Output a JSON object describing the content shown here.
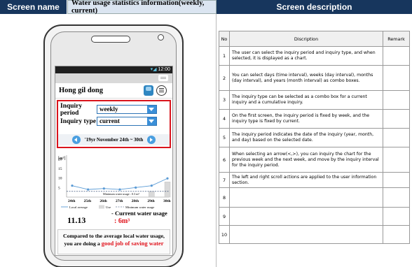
{
  "header": {
    "screen_name_label": "Screen name",
    "screen_title": "Water usage statistics information(weekly, current)",
    "screen_description_label": "Screen description"
  },
  "phone": {
    "status_time": "12:00",
    "user_name": "Hong gil dong",
    "inquiry_period_label": "Inquiry period",
    "inquiry_period_value": "weekly",
    "inquiry_type_label": "Inquiry type",
    "inquiry_type_value": "current",
    "date_range": "'19yr November 24th ~ 30th",
    "current_usage_label": "- Current water usage",
    "current_usage_amount": ": 6m³",
    "local_average_value": "11.13",
    "message_line1": "Compared to the average local water usage,",
    "message_line2_prefix": "you are doing a",
    "message_line2_highlight": "good job of saving water"
  },
  "chart_data": {
    "type": "bar",
    "ylabel": "[m³]",
    "yticks": [
      5,
      10,
      15,
      20
    ],
    "ylim": [
      0,
      22
    ],
    "categories": [
      "24th",
      "25th",
      "26th",
      "27th",
      "28th",
      "29th",
      "30th"
    ],
    "series": [
      {
        "name": "Local average",
        "type": "line",
        "values": [
          6,
          4,
          4.5,
          4,
          5,
          6,
          9.8
        ]
      },
      {
        "name": "Use",
        "type": "bar",
        "values": [
          0,
          0,
          0,
          0,
          0,
          3,
          8
        ]
      },
      {
        "name": "Minimum water usage",
        "type": "dashed-line",
        "values": [
          3,
          3,
          3,
          3,
          3,
          3,
          3
        ]
      }
    ],
    "annotation": "Minimum water usage : 0.3 m³",
    "legend": [
      "Local average",
      "Use",
      "Minimum water usage"
    ],
    "colors": {
      "line": "#5b9bd5",
      "bar": "#d9d9d9",
      "dashed": "#1f3864"
    }
  },
  "table": {
    "headers": [
      "No",
      "Discription",
      "Remark"
    ],
    "rows": [
      {
        "no": "1",
        "desc": "The user can select the inquiry period and inquiry type, and when selected, it is displayed as a chart.",
        "remark": ""
      },
      {
        "no": "2",
        "desc": "You can select days (time interval), weeks (day interval), months (day interval), and years (month interval) as combo boxes.",
        "remark": ""
      },
      {
        "no": "3",
        "desc": "The inquiry type can be selected as a combo box for a current inquiry and a cumulative inquiry.",
        "remark": ""
      },
      {
        "no": "4",
        "desc": "On the first screen, the inquiry period is fixed by week, and the inquiry type is fixed by current.",
        "remark": ""
      },
      {
        "no": "5",
        "desc": "The inquiry period indicates the date of the inquiry (year, month, and day) based on the selected date.",
        "remark": ""
      },
      {
        "no": "6",
        "desc": "When selecting an arrow(<,>), you can inquiry the chart for the previous week and the next week, and move by the inquiry interval for the inquiry period.",
        "remark": ""
      },
      {
        "no": "7",
        "desc": "The left and right scroll actions are applied to the user information section.",
        "remark": ""
      },
      {
        "no": "8",
        "desc": "",
        "remark": ""
      },
      {
        "no": "9",
        "desc": "",
        "remark": ""
      },
      {
        "no": "10",
        "desc": "",
        "remark": ""
      }
    ]
  }
}
